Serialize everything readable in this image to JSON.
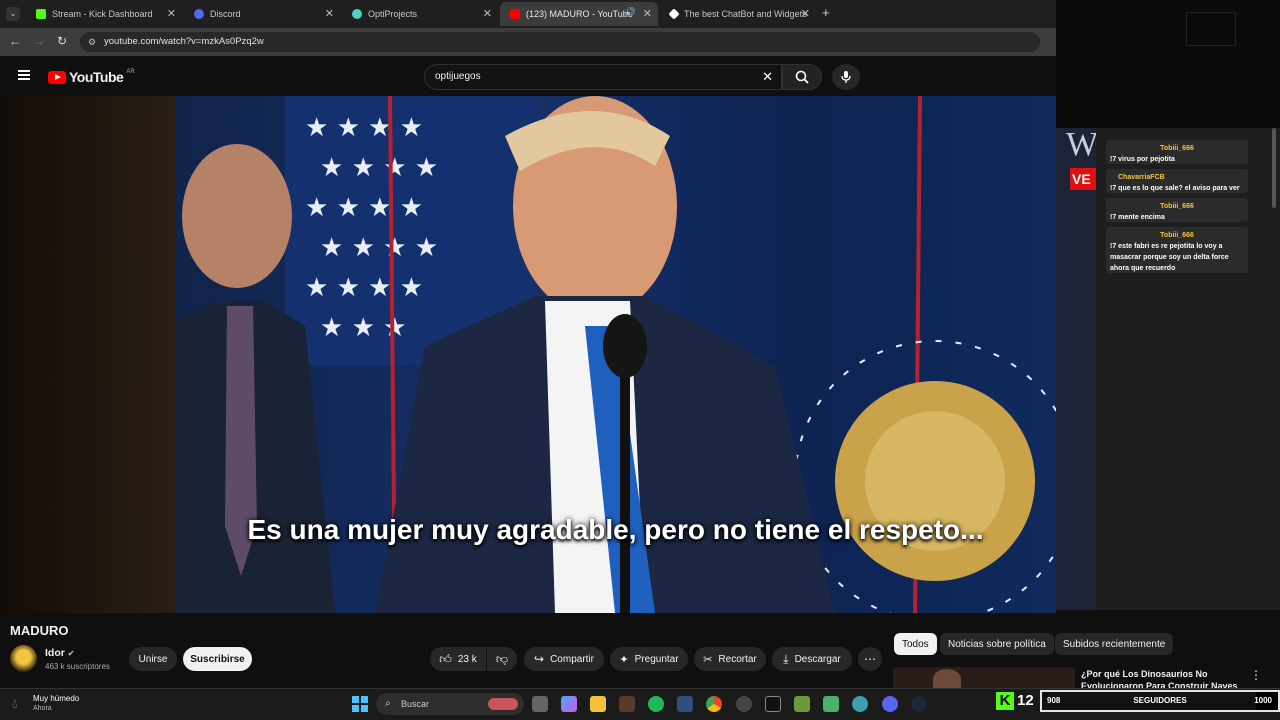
{
  "browser": {
    "tabs": [
      {
        "label": "Stream - Kick Dashboard",
        "color": "#53fc18"
      },
      {
        "label": "Discord",
        "color": "#5865f2"
      },
      {
        "label": "OptiProjects",
        "color": "#4fd1c5"
      },
      {
        "label": "(123) MADURO - YouTube",
        "color": "#ff0000"
      },
      {
        "label": "The best ChatBot and Widgets",
        "color": "#ffffff"
      }
    ],
    "url": "youtube.com/watch?v=mzkAs0Pzq2w"
  },
  "youtube": {
    "logo_text": "YouTube",
    "region": "AR",
    "search_value": "optijuegos"
  },
  "video": {
    "subtitle": "Es una mujer muy agradable, pero no tiene el respeto...",
    "title": "MADURO",
    "channel_name": "Idor",
    "subscribers": "463 k suscriptores",
    "join_label": "Unirse",
    "subscribe_label": "Suscribirse",
    "likes": "23 k",
    "share_label": "Compartir",
    "ask_label": "Preguntar",
    "clip_label": "Recortar",
    "download_label": "Descargar"
  },
  "filters": [
    "Todos",
    "Noticias sobre política",
    "Subidos recientemente"
  ],
  "recommended": {
    "title": "¿Por qué Los Dinosaurios No Evolucionaron Para Construir Naves"
  },
  "chat": [
    {
      "user": "Tobiii_666",
      "message": "!7 virus por pejotita"
    },
    {
      "user": "ChavarriaFCB",
      "message": "!7 que es lo que sale? el aviso para ver"
    },
    {
      "user": "Tobiii_666",
      "message": "!7 mente encima"
    },
    {
      "user": "Tobiii_666",
      "message": "!7 este fabri es re pejotita lo voy a masacrar porque soy un delta force ahora que recuerdo"
    }
  ],
  "stream_overlay": {
    "kick_count": "12",
    "followers_current": "908",
    "followers_label": "SEGUIDORES",
    "followers_goal": "1000"
  },
  "taskbar": {
    "weather_title": "Muy húmedo",
    "weather_sub": "Ahora",
    "search_placeholder": "Buscar"
  }
}
